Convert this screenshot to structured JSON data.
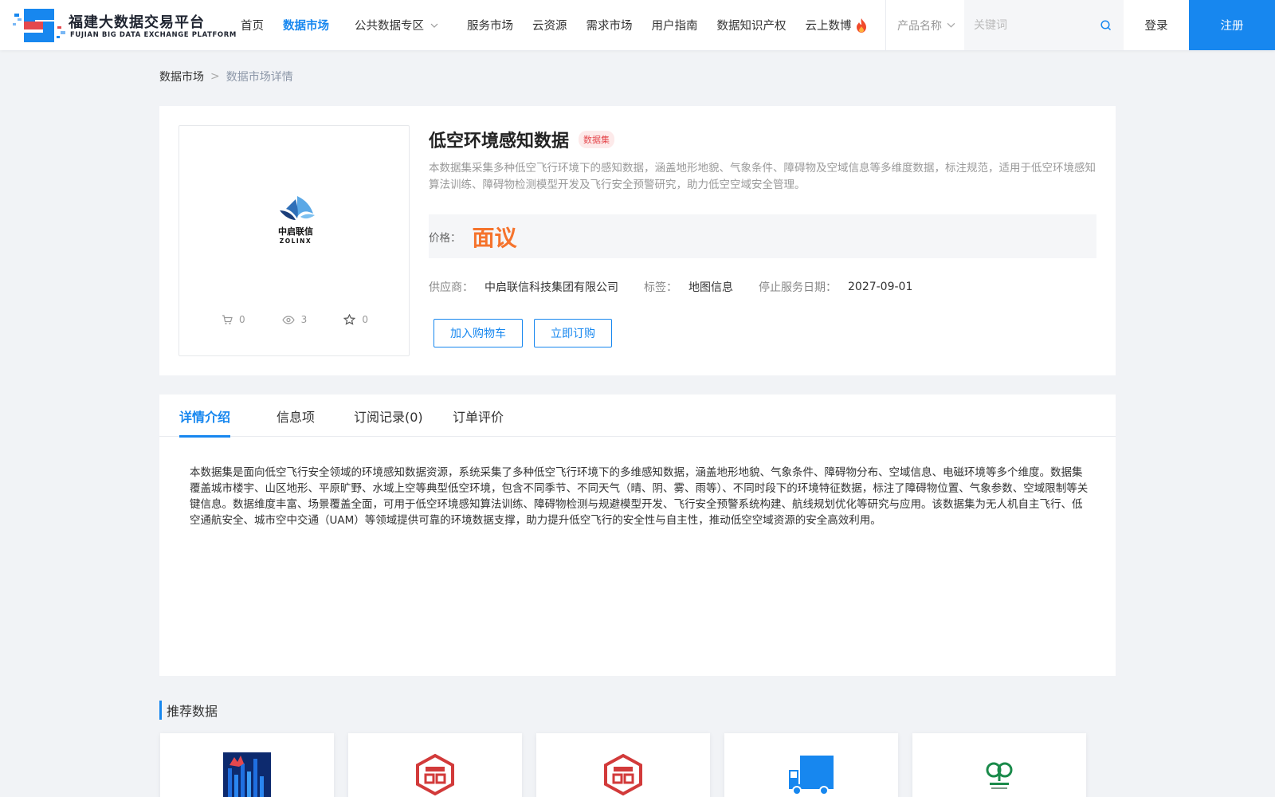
{
  "header": {
    "logo_cn": "福建大数据交易平台",
    "logo_en": "FUJIAN BIG DATA EXCHANGE  PLATFORM",
    "nav": [
      {
        "label": "首页",
        "active": false
      },
      {
        "label": "数据市场",
        "active": true
      },
      {
        "label": "公共数据专区",
        "active": false,
        "dropdown": true
      },
      {
        "label": "服务市场",
        "active": false
      },
      {
        "label": "云资源",
        "active": false
      },
      {
        "label": "需求市场",
        "active": false
      },
      {
        "label": "用户指南",
        "active": false
      },
      {
        "label": "数据知识产权",
        "active": false
      },
      {
        "label": "云上数博",
        "active": false,
        "icon": "flame-icon"
      }
    ],
    "search": {
      "category": "产品名称",
      "placeholder": "关键词",
      "value": ""
    },
    "login_label": "登录",
    "register_label": "注册"
  },
  "breadcrumb": {
    "root": "数据市场",
    "separator": ">",
    "current": "数据市场详情"
  },
  "product": {
    "title": "低空环境感知数据",
    "badge": "数据集",
    "description": "本数据集采集多种低空飞行环境下的感知数据，涵盖地形地貌、气象条件、障碍物及空域信息等多维度数据，标注规范，适用于低空环境感知算法训练、障碍物检测模型开发及飞行安全预警研究，助力低空空域安全管理。",
    "price_label": "价格：",
    "price_value": "面议",
    "supplier_label": "供应商：",
    "supplier_value": "中启联信科技集团有限公司",
    "tag_label": "标签：",
    "tag_value": "地图信息",
    "end_date_label": "停止服务日期：",
    "end_date_value": "2027-09-01",
    "stats": {
      "cart": "0",
      "views": "3",
      "favorites": "0"
    },
    "logo": {
      "cn": "中启联信",
      "en": "ZOLINX"
    },
    "add_cart_label": "加入购物车",
    "subscribe_label": "立即订购"
  },
  "tabs": [
    {
      "label": "详情介绍",
      "active": true
    },
    {
      "label": "信息项",
      "active": false
    },
    {
      "label": "订阅记录(0)",
      "active": false
    },
    {
      "label": "订单评价",
      "active": false
    }
  ],
  "detail_text": "本数据集是面向低空飞行安全领域的环境感知数据资源，系统采集了多种低空飞行环境下的多维感知数据，涵盖地形地貌、气象条件、障碍物分布、空域信息、电磁环境等多个维度。数据集覆盖城市楼宇、山区地形、平原旷野、水域上空等典型低空环境，包含不同季节、不同天气（晴、阴、雾、雨等）、不同时段下的环境特征数据，标注了障碍物位置、气象参数、空域限制等关键信息。数据维度丰富、场景覆盖全面，可用于低空环境感知算法训练、障碍物检测与规避模型开发、飞行安全预警系统构建、航线规划优化等研究与应用。该数据集为无人机自主飞行、低空通航安全、城市空中交通（UAM）等领域提供可靠的环境数据支撑，助力提升低空飞行的安全性与自主性，推动低空空域资源的安全高效利用。",
  "recommend": {
    "title": "推荐数据",
    "items": [
      {
        "icon": "city-chart-icon"
      },
      {
        "icon": "red-seal-icon"
      },
      {
        "icon": "red-seal-icon"
      },
      {
        "icon": "truck-icon"
      },
      {
        "icon": "green-tree-logo-icon"
      }
    ]
  },
  "colors": {
    "accent": "#1787ef",
    "price": "#f5732c",
    "badge": "#e5484d"
  }
}
